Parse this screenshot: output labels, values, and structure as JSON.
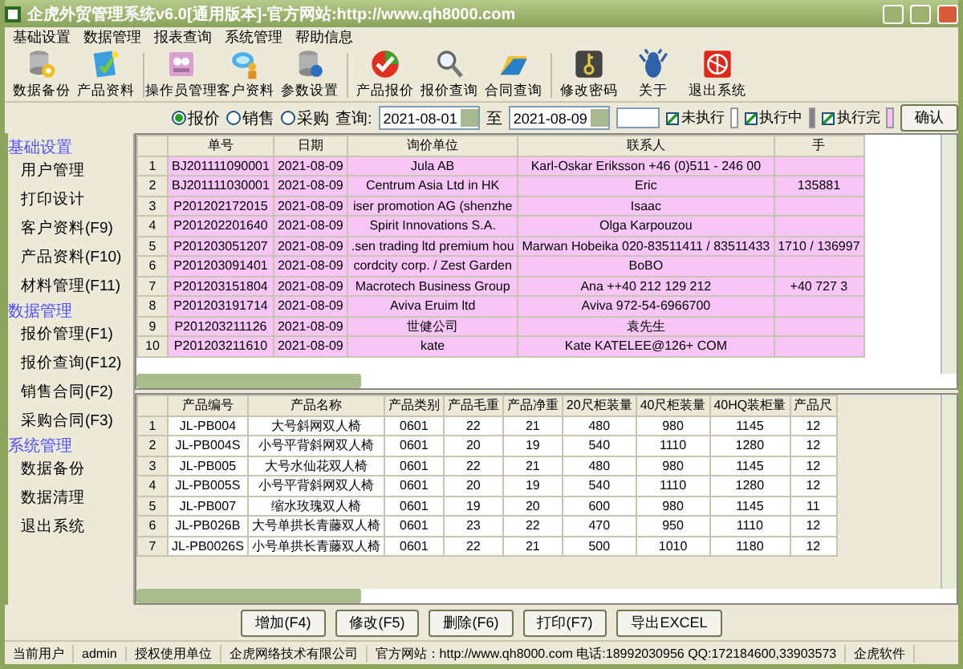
{
  "window": {
    "title": "企虎外贸管理系统v6.0[通用版本]-官方网站:http://www.qh8000.com"
  },
  "menu": [
    "基础设置",
    "数据管理",
    "报表查询",
    "系统管理",
    "帮助信息"
  ],
  "toolbar": [
    {
      "label": "数据备份",
      "kind": "database"
    },
    {
      "label": "产品资料",
      "kind": "document"
    },
    {
      "label": "操作员管理",
      "kind": "people"
    },
    {
      "label": "客户资料",
      "kind": "chat"
    },
    {
      "label": "参数设置",
      "kind": "server"
    },
    {
      "label": "产品报价",
      "kind": "check"
    },
    {
      "label": "报价查询",
      "kind": "magnifier"
    },
    {
      "label": "合同查询",
      "kind": "folder"
    },
    {
      "label": "修改密码",
      "kind": "key"
    },
    {
      "label": "关于",
      "kind": "figure"
    },
    {
      "label": "退出系统",
      "kind": "exit"
    }
  ],
  "filter": {
    "types": [
      {
        "label": "报价",
        "selected": true
      },
      {
        "label": "销售",
        "selected": false
      },
      {
        "label": "采购",
        "selected": false
      }
    ],
    "query_label": "查询:",
    "date_from": "2021-08-01",
    "to_label": "至",
    "date_to": "2021-08-09",
    "statuses": [
      {
        "label": "未执行",
        "checked": true,
        "color": "#ffffff"
      },
      {
        "label": "执行中",
        "checked": true,
        "color": "#808080"
      },
      {
        "label": "执行完",
        "checked": true,
        "color": "#f7c6f7"
      }
    ],
    "confirm": "确认"
  },
  "sidebar": [
    {
      "heading": "基础设置",
      "items": [
        "用户管理",
        "打印设计",
        "客户资料(F9)",
        "产品资料(F10)",
        "材料管理(F11)"
      ]
    },
    {
      "heading": "数据管理",
      "items": [
        "报价管理(F1)",
        "报价查询(F12)",
        "销售合同(F2)",
        "采购合同(F3)"
      ]
    },
    {
      "heading": "系统管理",
      "items": [
        "数据备份",
        "数据清理",
        "退出系统"
      ]
    }
  ],
  "orders": {
    "columns": [
      "",
      "单号",
      "日期",
      "询价单位",
      "联系人",
      "手"
    ],
    "rows": [
      {
        "color": "#f7c6f7",
        "cells": [
          "1",
          "BJ201111090001",
          "2021-08-09",
          "Jula AB",
          "Karl-Oskar Eriksson  +46 (0)511 - 246 00",
          ""
        ]
      },
      {
        "color": "#f7c6f7",
        "cells": [
          "2",
          "BJ201111030001",
          "2021-08-09",
          "Centrum Asia Ltd in HK",
          "Eric",
          "135881"
        ]
      },
      {
        "color": "#f7c6f7",
        "cells": [
          "3",
          "P201202172015",
          "2021-08-09",
          "iser promotion AG (shenzhe",
          "Isaac",
          ""
        ]
      },
      {
        "color": "#f7c6f7",
        "cells": [
          "4",
          "P201202201640",
          "2021-08-09",
          "Spirit Innovations S.A.",
          "Olga Karpouzou",
          ""
        ]
      },
      {
        "color": "#f7c6f7",
        "cells": [
          "5",
          "P201203051207",
          "2021-08-09",
          ".sen trading ltd premium hou",
          "Marwan Hobeika  020-83511411  /  83511433",
          "1710 / 136997"
        ]
      },
      {
        "color": "#f7c6f7",
        "cells": [
          "6",
          "P201203091401",
          "2021-08-09",
          "cordcity corp. / Zest Garden",
          "BoBO",
          ""
        ]
      },
      {
        "color": "#f7c6f7",
        "cells": [
          "7",
          "P201203151804",
          "2021-08-09",
          "Macrotech Business Group",
          "Ana ++40 212 129 212",
          "+40 727 3"
        ]
      },
      {
        "color": "#f7c6f7",
        "cells": [
          "8",
          "P201203191714",
          "2021-08-09",
          "Aviva Eruim ltd",
          "Aviva  972-54-6966700",
          ""
        ]
      },
      {
        "color": "#f7c6f7",
        "cells": [
          "9",
          "P201203211126",
          "2021-08-09",
          "世健公司",
          "袁先生",
          ""
        ]
      },
      {
        "color": "#f7c6f7",
        "cells": [
          "10",
          "P201203211610",
          "2021-08-09",
          "kate",
          "Kate  KATELEE@126+ COM",
          ""
        ]
      }
    ]
  },
  "products": {
    "columns": [
      "",
      "产品编号",
      "产品名称",
      "产品类别",
      "产品毛重",
      "产品净重",
      "20尺柜装量",
      "40尺柜装量",
      "40HQ装柜量",
      "产品尺"
    ],
    "rows": [
      [
        "1",
        "JL-PB004",
        "大号斜网双人椅",
        "0601",
        "22",
        "21",
        "480",
        "980",
        "1145",
        "12"
      ],
      [
        "2",
        "JL-PB004S",
        "小号平背斜网双人椅",
        "0601",
        "20",
        "19",
        "540",
        "1110",
        "1280",
        "12"
      ],
      [
        "3",
        "JL-PB005",
        "大号水仙花双人椅",
        "0601",
        "22",
        "21",
        "480",
        "980",
        "1145",
        "12"
      ],
      [
        "4",
        "JL-PB005S",
        "小号平背斜网双人椅",
        "0601",
        "20",
        "19",
        "540",
        "1110",
        "1280",
        "12"
      ],
      [
        "5",
        "JL-PB007",
        "缩水玫瑰双人椅",
        "0601",
        "19",
        "20",
        "600",
        "980",
        "1145",
        "11"
      ],
      [
        "6",
        "JL-PB026B",
        "大号单拱长青藤双人椅",
        "0601",
        "23",
        "22",
        "470",
        "950",
        "1110",
        "12"
      ],
      [
        "7",
        "JL-PB0026S",
        "小号单拱长青藤双人椅",
        "0601",
        "22",
        "21",
        "500",
        "1010",
        "1180",
        "12"
      ]
    ]
  },
  "actions": [
    "增加(F4)",
    "修改(F5)",
    "删除(F6)",
    "打印(F7)",
    "导出EXCEL"
  ],
  "status_bar": [
    "当前用户",
    "admin",
    "授权使用单位",
    "企虎网络技术有限公司",
    "官方网站：http://www.qh8000.com 电话:18992030956 QQ:172184600,33903573",
    "企虎软件"
  ]
}
